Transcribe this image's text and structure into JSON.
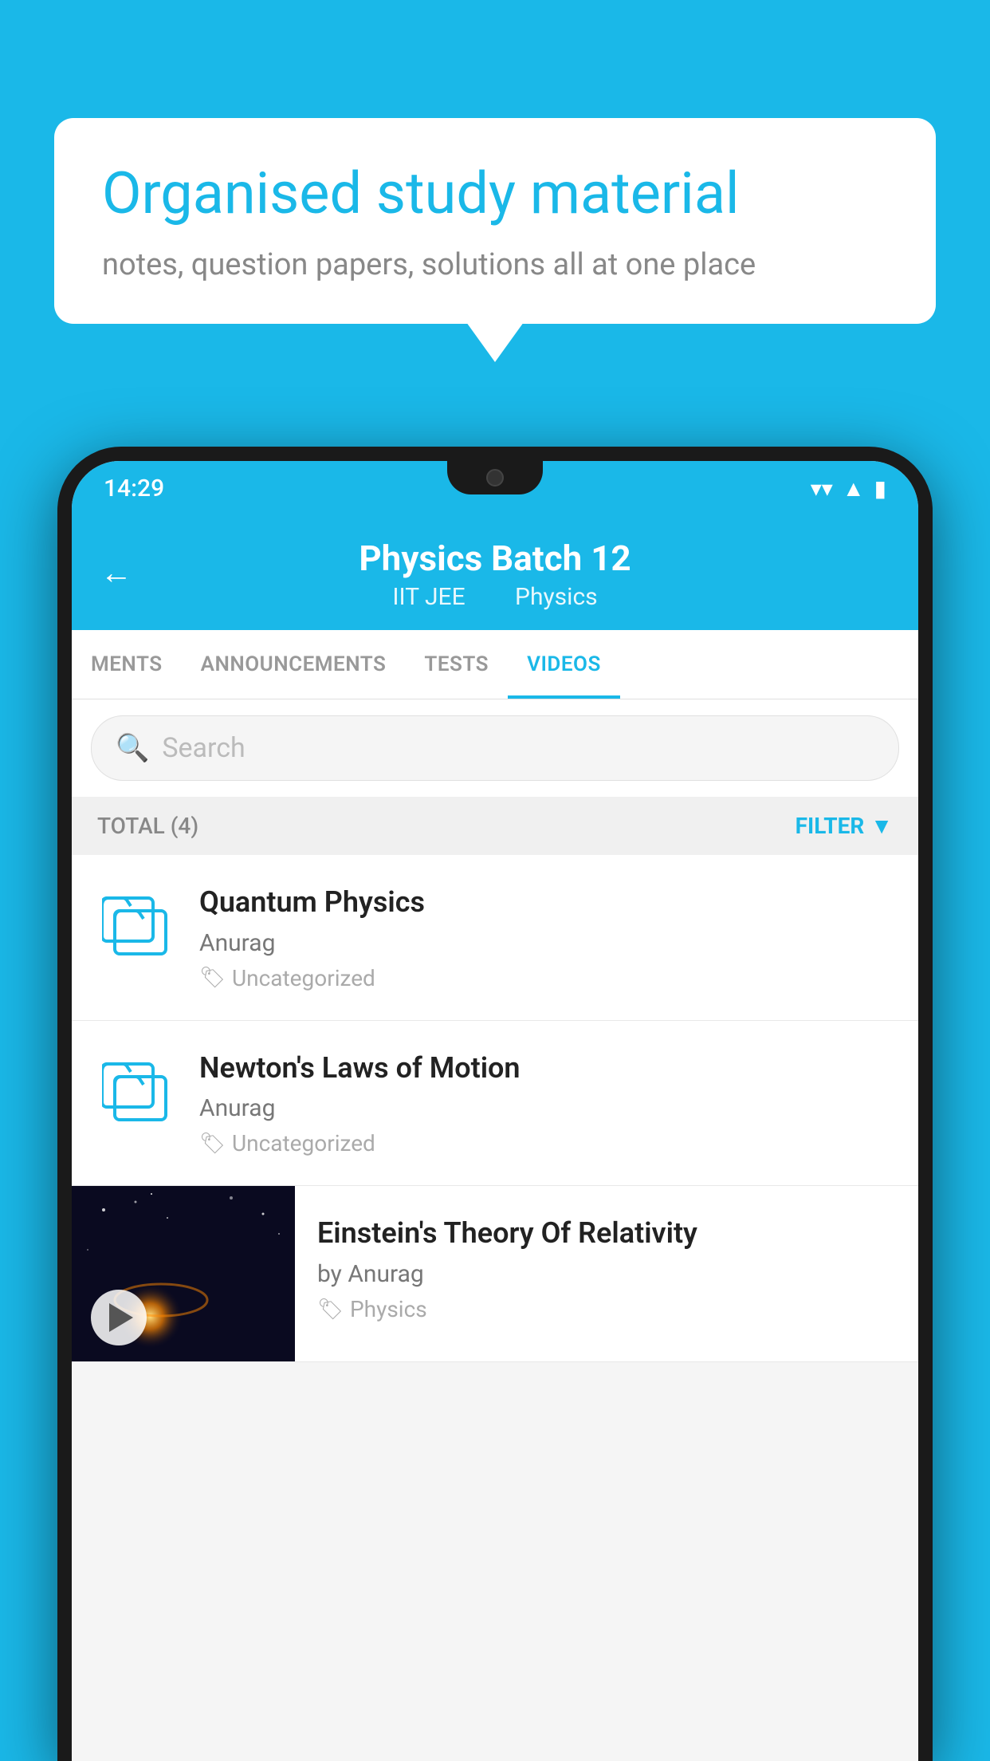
{
  "background_color": "#1ab8e8",
  "speech_bubble": {
    "title": "Organised study material",
    "subtitle": "notes, question papers, solutions all at one place"
  },
  "status_bar": {
    "time": "14:29",
    "wifi": "▼",
    "signal": "▲",
    "battery": "▮"
  },
  "header": {
    "back_label": "←",
    "title": "Physics Batch 12",
    "subtitle_part1": "IIT JEE",
    "subtitle_part2": "Physics"
  },
  "tabs": [
    {
      "label": "MENTS",
      "active": false
    },
    {
      "label": "ANNOUNCEMENTS",
      "active": false
    },
    {
      "label": "TESTS",
      "active": false
    },
    {
      "label": "VIDEOS",
      "active": true
    }
  ],
  "search": {
    "placeholder": "Search"
  },
  "filter_bar": {
    "total_label": "TOTAL (4)",
    "filter_label": "FILTER"
  },
  "videos": [
    {
      "id": 1,
      "title": "Quantum Physics",
      "author": "Anurag",
      "tag": "Uncategorized",
      "has_thumb": false
    },
    {
      "id": 2,
      "title": "Newton's Laws of Motion",
      "author": "Anurag",
      "tag": "Uncategorized",
      "has_thumb": false
    },
    {
      "id": 3,
      "title": "Einstein's Theory Of Relativity",
      "author": "by Anurag",
      "tag": "Physics",
      "has_thumb": true
    }
  ]
}
